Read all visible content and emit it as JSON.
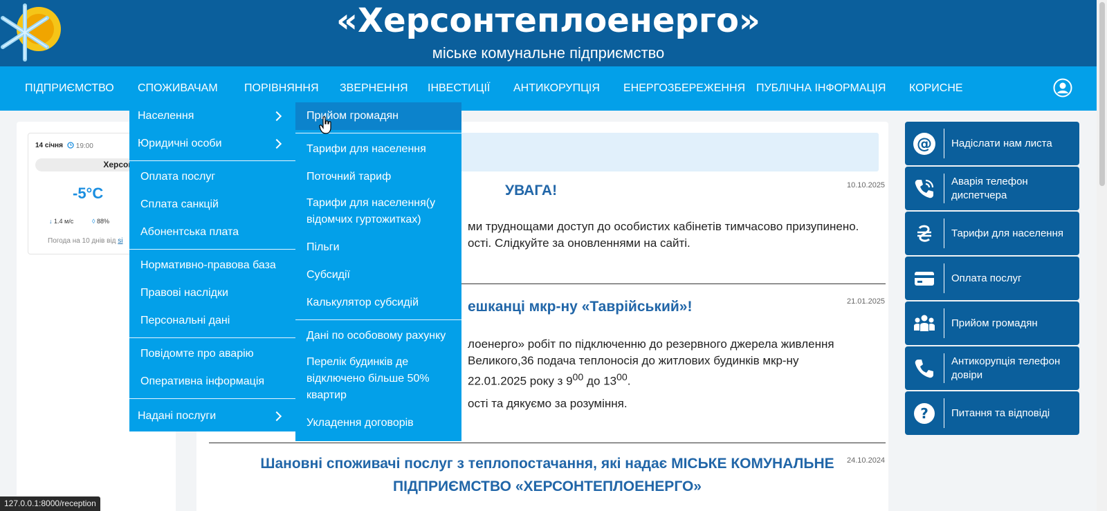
{
  "header": {
    "title": "«Херсонтеплоенерго»",
    "subtitle": "міське комунальне підприємство"
  },
  "nav": {
    "items": [
      "Підприємство",
      "Споживачам",
      "Порівняння",
      "Звернення",
      "Інвестиції",
      "Антикорупція",
      "Енергозбереження",
      "Публічна інформація",
      "Корисне"
    ]
  },
  "weather": {
    "date": "14 січня",
    "time": "19:00",
    "city": "Херсон",
    "temp": "-5°C",
    "wind": "1.4 м/с",
    "humidity": "88%",
    "footer_text": "Погода на 10 днів від ",
    "footer_link": "si"
  },
  "dropdown_primary": {
    "items": [
      "Населення",
      "Юридичні особи",
      "Оплата послуг",
      "Сплата санкцій",
      "Абонентська плата",
      "Нормативно-правова база",
      "Правові наслідки",
      "Персональні дані",
      "Повідомте про аварію",
      "Оперативна інформація",
      "Надані послуги"
    ]
  },
  "dropdown_secondary": {
    "items": [
      "Прийом громадян",
      "Тарифи для населення",
      "Поточний тариф",
      "Тарифи для населення(у відомчих гуртожитках)",
      "Пільги",
      "Субсидії",
      "Калькулятор субсидій",
      "Дані по особовому рахунку",
      "Перелік будинків де відключено більше 50% квартир",
      "Укладення договорів"
    ]
  },
  "news": [
    {
      "date": "10.10.2025",
      "title": "УВАГА!",
      "lines": [
        "ми труднощами доступ до особистих кабінетів тимчасово призупинено.",
        "ості. Слідкуйте за оновленнями на сайті."
      ]
    },
    {
      "date": "21.01.2025",
      "title": "ешканці мкр-ну «Таврійський»!",
      "lines": [
        "лоенерго» робіт по підключенню до резервного джерела живлення",
        "Великого,36 подача теплоносія до житлових будинків мкр-ну"
      ],
      "line3_prefix": "22.01.2025 року з 9",
      "line3_sup1": "00",
      "line3_mid": " до 13",
      "line3_sup2": "00",
      "line3_suffix": ".",
      "line4": "ості та дякуємо за розуміння."
    },
    {
      "date": "24.10.2024",
      "title_line1": "Шановні споживачі послуг з теплопостачання, які надає МІСЬКЕ КОМУНАЛЬНЕ",
      "title_line2": "ПІДПРИЄМСТВО «ХЕРСОНТЕПЛОЕНЕРГО»"
    }
  ],
  "sidebar": {
    "buttons": [
      {
        "label": "Надіслати нам листа",
        "icon": "at-icon"
      },
      {
        "label": "Аварія телефон диспетчера",
        "icon": "phone-ring-icon"
      },
      {
        "label": "Тарифи для населення",
        "icon": "hryvnia-icon"
      },
      {
        "label": "Оплата послуг",
        "icon": "card-icon"
      },
      {
        "label": "Прийом громадян",
        "icon": "people-icon"
      },
      {
        "label": "Антикорупція телефон довіри",
        "icon": "phone-icon"
      },
      {
        "label": "Питання та відповіді",
        "icon": "question-icon"
      }
    ]
  },
  "status_bar": {
    "url": "127.0.0.1:8000/reception"
  },
  "colors": {
    "header_bg": "#0b5f9c",
    "nav_bg": "#03a0e9",
    "active_item": "#0c83cc",
    "link_blue": "#2166a8"
  }
}
